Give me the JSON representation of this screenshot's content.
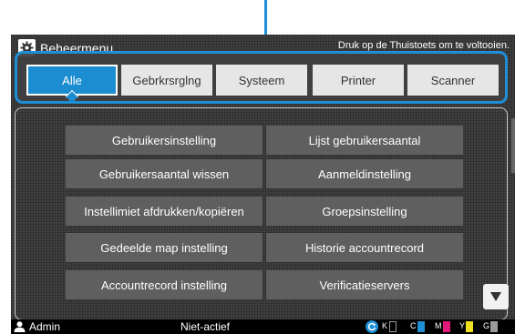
{
  "header": {
    "title": "Beheermenu",
    "hint": "Druk op de Thuistoets om te voltooien."
  },
  "tabs": [
    {
      "label": "Alle",
      "active": true
    },
    {
      "label": "Gebrkrsrglng",
      "active": false
    },
    {
      "label": "Systeem",
      "active": false
    },
    {
      "label": "Printer",
      "active": false
    },
    {
      "label": "Scanner",
      "active": false
    }
  ],
  "menu": {
    "left": [
      "Gebruikersinstelling",
      "Gebruikersaantal wissen",
      "Instellimiet afdrukken/kopiëren",
      "Gedeelde map instelling",
      "Accountrecord instelling"
    ],
    "right": [
      "Lijst gebruikersaantal",
      "Aanmeldinstelling",
      "Groepsinstelling",
      "Historie accountrecord",
      "Verificatieservers"
    ]
  },
  "status": {
    "user": "Admin",
    "state": "Niet-actief",
    "toner": [
      {
        "label": "K",
        "color": "#000000"
      },
      {
        "label": "C",
        "color": "#1e8fd6"
      },
      {
        "label": "M",
        "color": "#e0197a"
      },
      {
        "label": "Y",
        "color": "#f0e020"
      },
      {
        "label": "G",
        "color": "#9a9a9a"
      }
    ]
  },
  "icons": {
    "header": "gear-icon",
    "scroll": "triangle-down-icon",
    "user": "user-icon",
    "toner": "refresh-icon"
  },
  "colors": {
    "accent": "#1e8fd6",
    "active_tab": "#1c8dd0",
    "button": "#5f5f5f",
    "background": "#404040"
  }
}
